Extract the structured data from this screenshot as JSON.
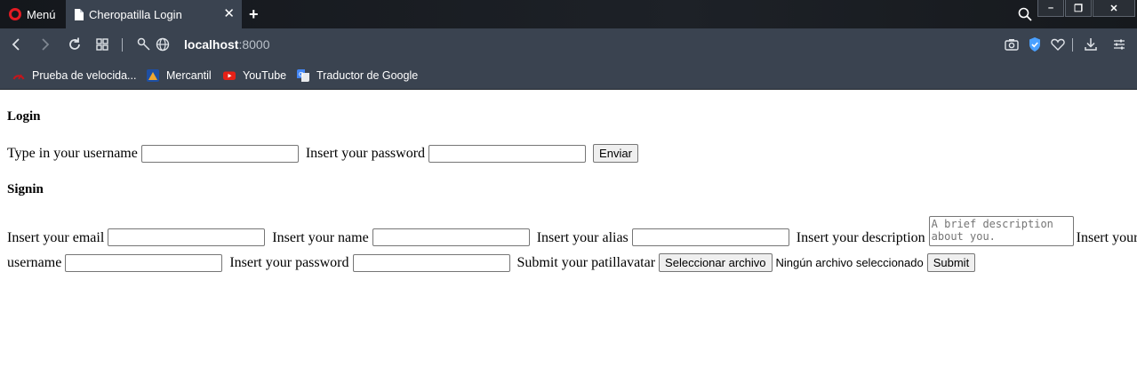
{
  "browser": {
    "menu_label": "Menú",
    "tab_title": "Cheropatilla Login",
    "tab_close": "✕",
    "new_tab": "+",
    "url_host": "localhost",
    "url_port": ":8000",
    "window_controls": [
      "–",
      "❐",
      "✕"
    ],
    "bookmarks": [
      {
        "label": "Prueba de velocida...",
        "icon": "speedtest-icon",
        "color": "#c4161c"
      },
      {
        "label": "Mercantil",
        "icon": "mercantil-icon",
        "color": "#1e4fa3"
      },
      {
        "label": "YouTube",
        "icon": "youtube-icon",
        "color": "#e62117"
      },
      {
        "label": "Traductor de Google",
        "icon": "google-translate-icon",
        "color": "#4285f4"
      }
    ],
    "colors": {
      "tabbar": "#1d2127",
      "toolbar": "#3a4350",
      "opera_red": "#e21b23",
      "vpn_shield": "#4aa0ff"
    }
  },
  "login": {
    "heading": "Login",
    "username_label": "Type in your username",
    "password_label": "Insert your password",
    "submit_label": "Enviar"
  },
  "signin": {
    "heading": "Signin",
    "email_label": "Insert your email",
    "name_label": "Insert your name",
    "alias_label": "Insert your alias",
    "description_label": "Insert your description",
    "description_placeholder": "A brief description about you.",
    "username_label": "Insert your",
    "username_label_cont": "username",
    "password_label": "Insert your password",
    "avatar_label": "Submit your patillavatar",
    "file_button_label": "Seleccionar archivo",
    "file_status": "Ningún archivo seleccionado",
    "submit_label": "Submit"
  }
}
